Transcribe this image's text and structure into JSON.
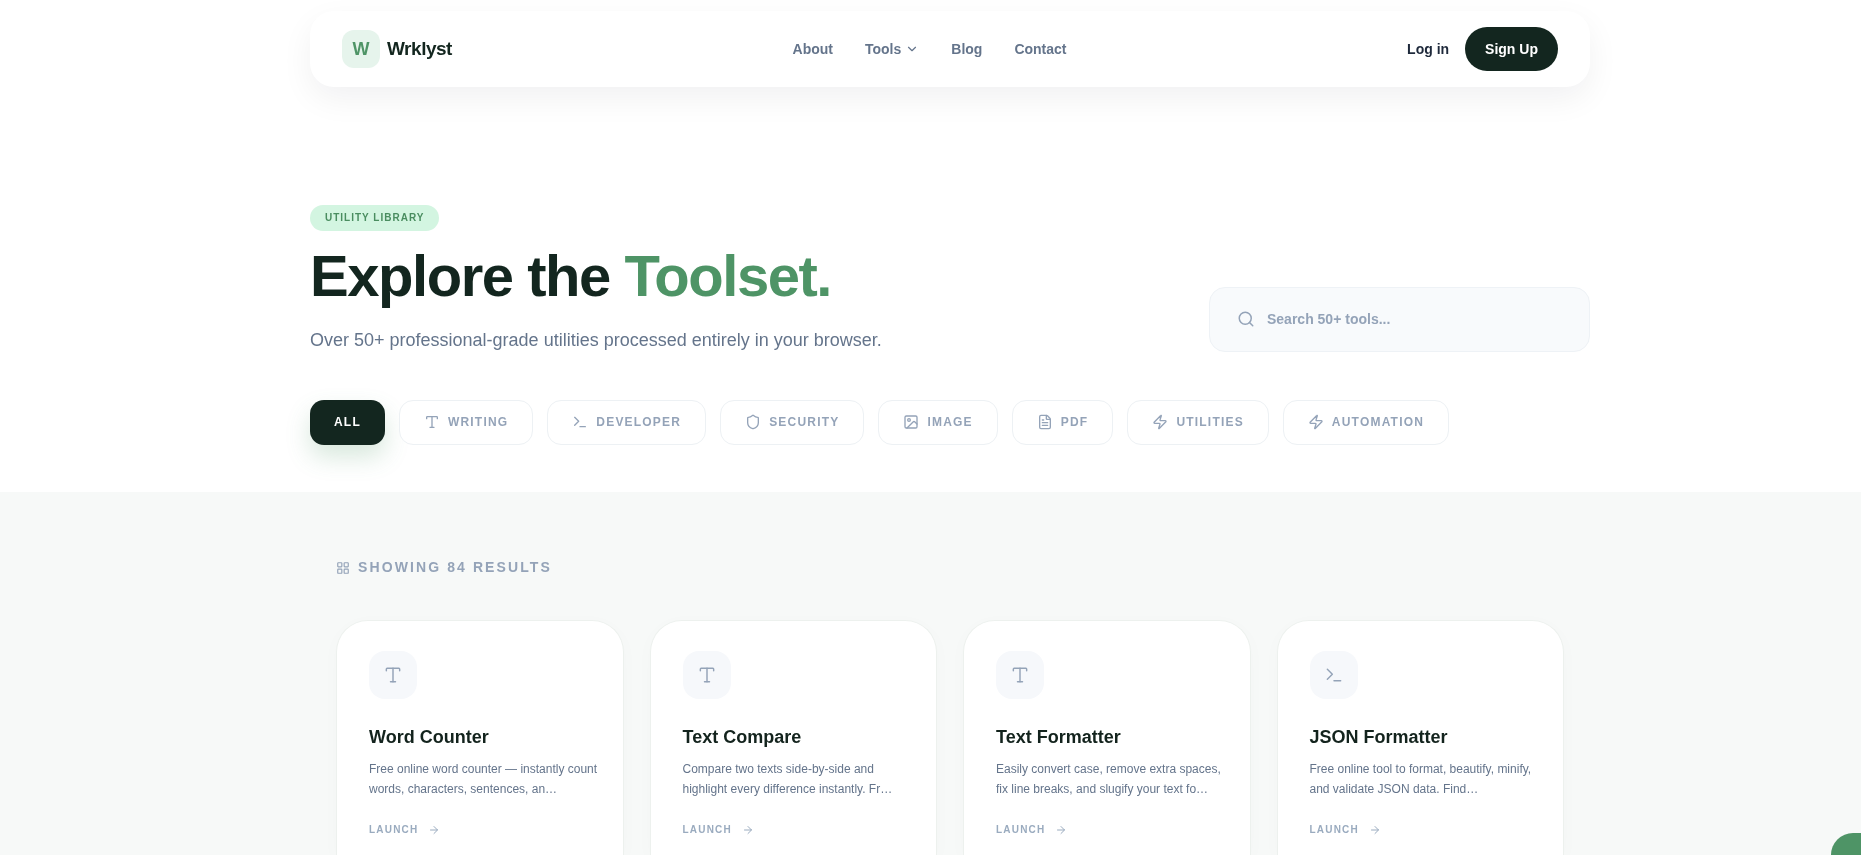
{
  "nav": {
    "logo_mark": "W",
    "brand": "Wrklyst",
    "links": [
      {
        "label": "About",
        "dropdown": false
      },
      {
        "label": "Tools",
        "dropdown": true
      },
      {
        "label": "Blog",
        "dropdown": false
      },
      {
        "label": "Contact",
        "dropdown": false
      }
    ],
    "login": "Log in",
    "signup": "Sign Up"
  },
  "hero": {
    "badge": "UTILITY LIBRARY",
    "title": "Explore the",
    "title_highlight": "Toolset.",
    "subtitle": "Over 50+ professional-grade utilities processed entirely in your browser.",
    "search": {
      "placeholder": "Search 50+ tools..."
    }
  },
  "filters": [
    {
      "label": "ALL",
      "kind": "all",
      "selected": true
    },
    {
      "label": "WRITING",
      "kind": "writing",
      "selected": false
    },
    {
      "label": "DEVELOPER",
      "kind": "developer",
      "selected": false
    },
    {
      "label": "SECURITY",
      "kind": "security",
      "selected": false
    },
    {
      "label": "IMAGE",
      "kind": "image",
      "selected": false
    },
    {
      "label": "PDF",
      "kind": "pdf",
      "selected": false
    },
    {
      "label": "UTILITIES",
      "kind": "utilities",
      "selected": false
    },
    {
      "label": "AUTOMATION",
      "kind": "automation",
      "selected": false
    }
  ],
  "results": {
    "count_label": "SHOWING 84 RESULTS",
    "tools": [
      {
        "name": "Word Counter",
        "kind": "writing",
        "description": "Free online word counter — instantly count words, characters, sentences, an…",
        "action": "LAUNCH"
      },
      {
        "name": "Text Compare",
        "kind": "writing",
        "description": "Compare two texts side-by-side and highlight every difference instantly. Fr…",
        "action": "LAUNCH"
      },
      {
        "name": "Text Formatter",
        "kind": "writing",
        "description": "Easily convert case, remove extra spaces, fix line breaks, and slugify your text fo…",
        "action": "LAUNCH"
      },
      {
        "name": "JSON Formatter",
        "kind": "developer",
        "description": "Free online tool to format, beautify, minify, and validate JSON data. Find…",
        "action": "LAUNCH"
      }
    ]
  }
}
